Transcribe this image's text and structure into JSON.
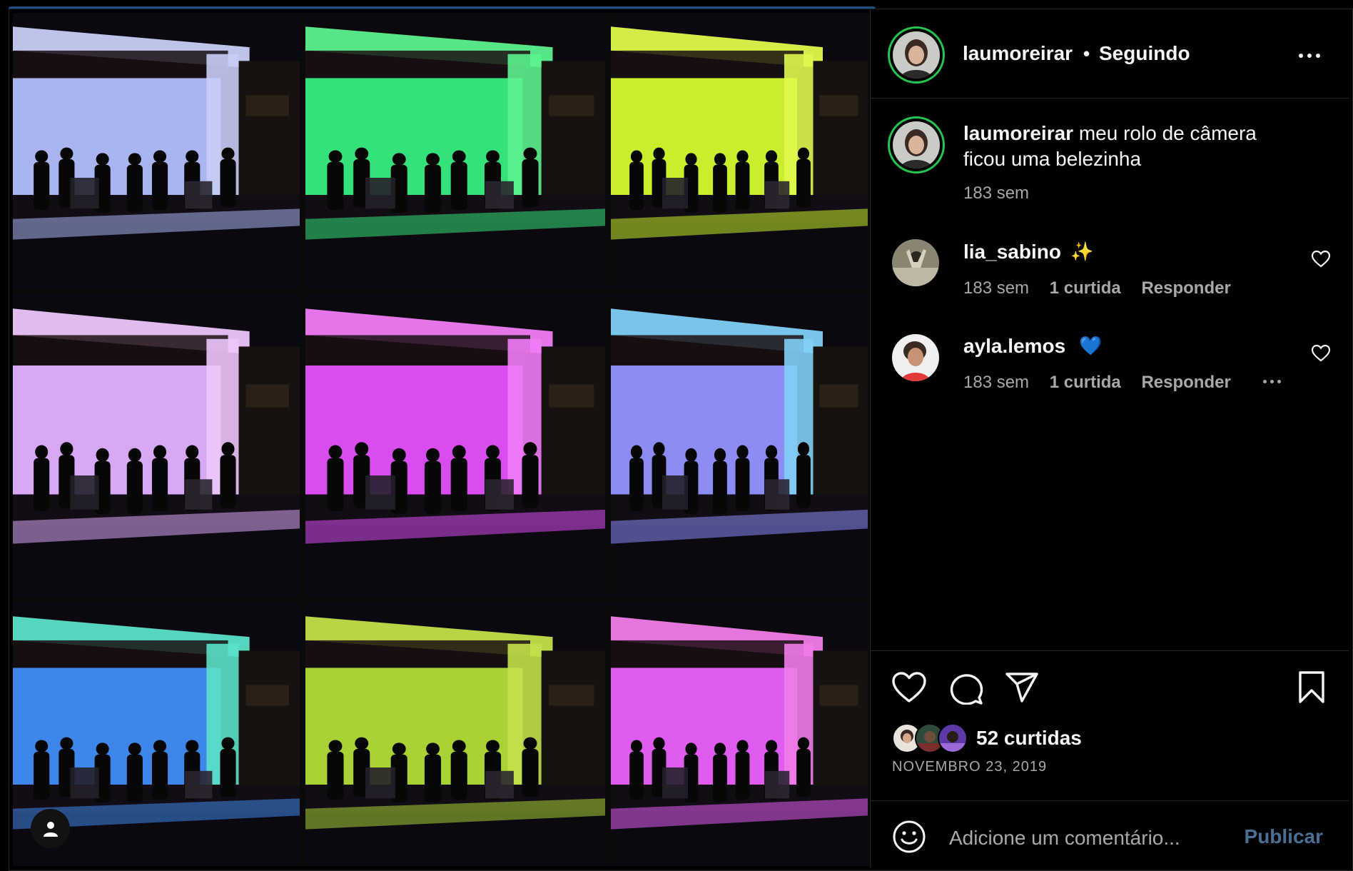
{
  "post": {
    "username": "laumoreirar",
    "separator": "•",
    "follow_status": "Seguindo",
    "caption_user": "laumoreirar",
    "caption_text": "meu rolo de câmera ficou uma belezinha",
    "caption_time": "183 sem",
    "likes_text": "52 curtidas",
    "date": "NOVEMBRO 23, 2019"
  },
  "comments": [
    {
      "user": "lia_sabino",
      "emoji": "✨",
      "time": "183 sem",
      "likes": "1 curtida",
      "reply": "Responder"
    },
    {
      "user": "ayla.lemos",
      "emoji": "💙",
      "time": "183 sem",
      "likes": "1 curtida",
      "reply": "Responder"
    }
  ],
  "composer": {
    "placeholder": "Adicione um comentário...",
    "publish_label": "Publicar"
  },
  "media": {
    "tiles": [
      {
        "name": "photo-lavender",
        "screen": "#aab4f0",
        "glow": "#c8cdf7"
      },
      {
        "name": "photo-green",
        "screen": "#35e27a",
        "glow": "#5cf28e"
      },
      {
        "name": "photo-lime",
        "screen": "#c9ef2c",
        "glow": "#e0f84c"
      },
      {
        "name": "photo-pink-lavender",
        "screen": "#d8a8f5",
        "glow": "#ecc6fb"
      },
      {
        "name": "photo-magenta",
        "screen": "#d94df0",
        "glow": "#f07cf7"
      },
      {
        "name": "photo-blue-violet",
        "screen": "#8c8cf5",
        "glow": "#7fd0f5"
      },
      {
        "name": "photo-sky-blue",
        "screen": "#3f86ea",
        "glow": "#5be2c8"
      },
      {
        "name": "photo-olive-green",
        "screen": "#a9d235",
        "glow": "#c3e04a"
      },
      {
        "name": "photo-hot-pink",
        "screen": "#e05cf0",
        "glow": "#f07ce8"
      }
    ]
  },
  "icons": {
    "heart": "heart-icon",
    "comment": "comment-icon",
    "share": "share-icon",
    "save": "bookmark-icon",
    "more": "more-icon",
    "emoji": "emoji-icon",
    "user_tag": "user-tag-icon"
  },
  "colors": {
    "story_ring": "#23c552",
    "muted_text": "#a8a8a8",
    "publish_disabled": "#4a6f94"
  }
}
